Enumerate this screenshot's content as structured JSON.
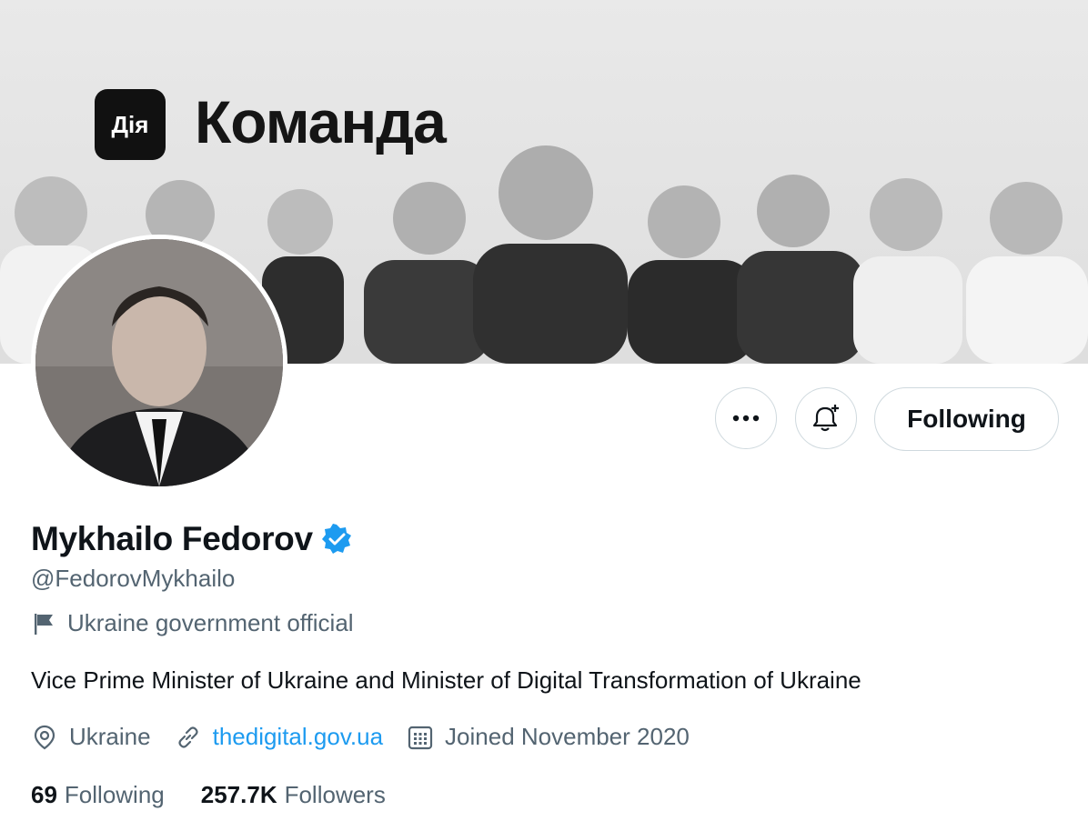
{
  "banner": {
    "logo_text": "Дія",
    "title": "Команда"
  },
  "actions": {
    "more_label": "•••",
    "notify_icon": "bell-plus-icon",
    "following_label": "Following"
  },
  "profile": {
    "name": "Mykhailo Fedorov",
    "verified": true,
    "handle": "@FedorovMykhailo",
    "label": "Ukraine government official",
    "bio": "Vice Prime Minister of Ukraine and Minister of Digital Transformation of Ukraine",
    "location": "Ukraine",
    "website": "thedigital.gov.ua",
    "joined": "Joined November 2020"
  },
  "stats": {
    "following_count": "69",
    "following_label": "Following",
    "followers_count": "257.7K",
    "followers_label": "Followers"
  },
  "colors": {
    "accent": "#1d9bf0",
    "text_primary": "#0f1419",
    "text_secondary": "#536471",
    "border": "#cfd9de"
  }
}
